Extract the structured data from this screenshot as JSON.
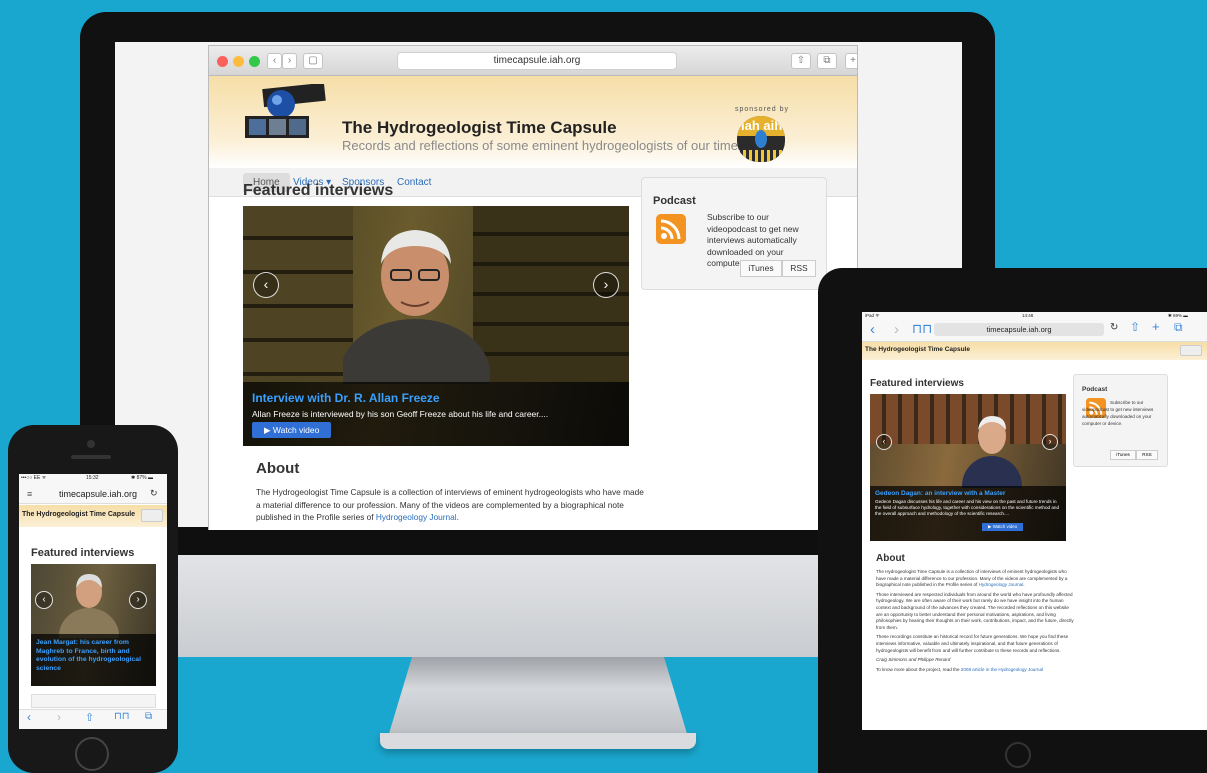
{
  "imac": {
    "url": "timecapsule.iah.org",
    "site_title": "The Hydrogeologist Time Capsule",
    "site_subtitle": "Records and reflections of some eminent hydrogeologists of our time",
    "sponsored_by": "sponsored by",
    "sponsor_logo_text": "iah aih",
    "nav": [
      "Home",
      "Videos ▾",
      "Sponsors",
      "Contact"
    ],
    "featured_heading": "Featured interviews",
    "slide_title": "Interview with Dr. R. Allan Freeze",
    "slide_text": "Allan Freeze is interviewed by his son Geoff Freeze about his life and career....",
    "watch_label": "▶ Watch video",
    "arrow_prev": "‹",
    "arrow_next": "›",
    "podcast_heading": "Podcast",
    "podcast_text": "Subscribe to our videopodcast to get new interviews automatically downloaded on your computer or device.",
    "itunes_label": "iTunes",
    "rss_label": "RSS",
    "about_heading": "About",
    "about_text": "The Hydrogeologist Time Capsule is a collection of interviews of eminent hydrogeologists who have made a material difference to our profession. Many of the videos are complemented by a biographical note published in the Profile series of",
    "about_link": "Hydrogeology Journal",
    "about_end": "."
  },
  "ipad": {
    "status_left": "iPad ᯤ",
    "status_time": "14:48",
    "status_right": "✱ 69% ▬",
    "url": "timecapsule.iah.org",
    "site_title": "The Hydrogeologist Time Capsule",
    "featured_heading": "Featured interviews",
    "slide_title": "Gedeon Dagan: an interview with a Master",
    "slide_text": "Gedeon Dagan discusses his life and career and his view on the past and future trends in the field of subsurface hydrology, together with considerations on the scientific method and the overall approach and methodology of the scientific research....",
    "watch_label": "▶ Watch video",
    "podcast_heading": "Podcast",
    "podcast_text": "Subscribe to our videopodcast to get new interviews automatically downloaded on your computer or device.",
    "itunes_label": "iTunes",
    "rss_label": "RSS",
    "about_heading": "About",
    "about_p1": "The Hydrogeologist Time Capsule is a collection of interviews of eminent hydrogeologists who have made a material difference to our profession. Many of the videos are complemented by a biographical note published in the Profile series of",
    "about_p1_link": "Hydrogeology Journal.",
    "about_p2": "Those interviewed are respected individuals from around the world who have profoundly affected hydrogeology. We are often aware of their work but rarely do we have insight into the human context and background of the advances they created. The recorded reflections on this website are an opportunity to better understand their personal motivations, aspirations, and living philosophies by hearing their thoughts on their work, contributions, impact, and the future, directly from them.",
    "about_p3": "These recordings constitute an historical record for future generations. We hope you find these interviews informative, valuable and ultimately inspirational, and that future generations of hydrogeologists will benefit from and will further contribute to these records and reflections.",
    "authors": "Craig Simmons and Philippe Renard",
    "more_text": "To know more about the project, read the",
    "more_link": "2008 article in the Hydrogeology Journal"
  },
  "iphone": {
    "status_left": "•••○○ EE ᯤ",
    "status_time": "15:32",
    "status_right": "✱ 87% ▬",
    "url": "timecapsule.iah.org",
    "site_title": "The Hydrogeologist Time Capsule",
    "featured_heading": "Featured interviews",
    "slide_title": "Jean Margat: his career from Maghreb to France, birth and evolution of the hydrogeological science"
  },
  "colors": {
    "background": "#1aa7cf",
    "link": "#2a6ebb",
    "caption_title": "#3aa0ff",
    "header": "#f6dea7",
    "rss": "#f29322"
  }
}
